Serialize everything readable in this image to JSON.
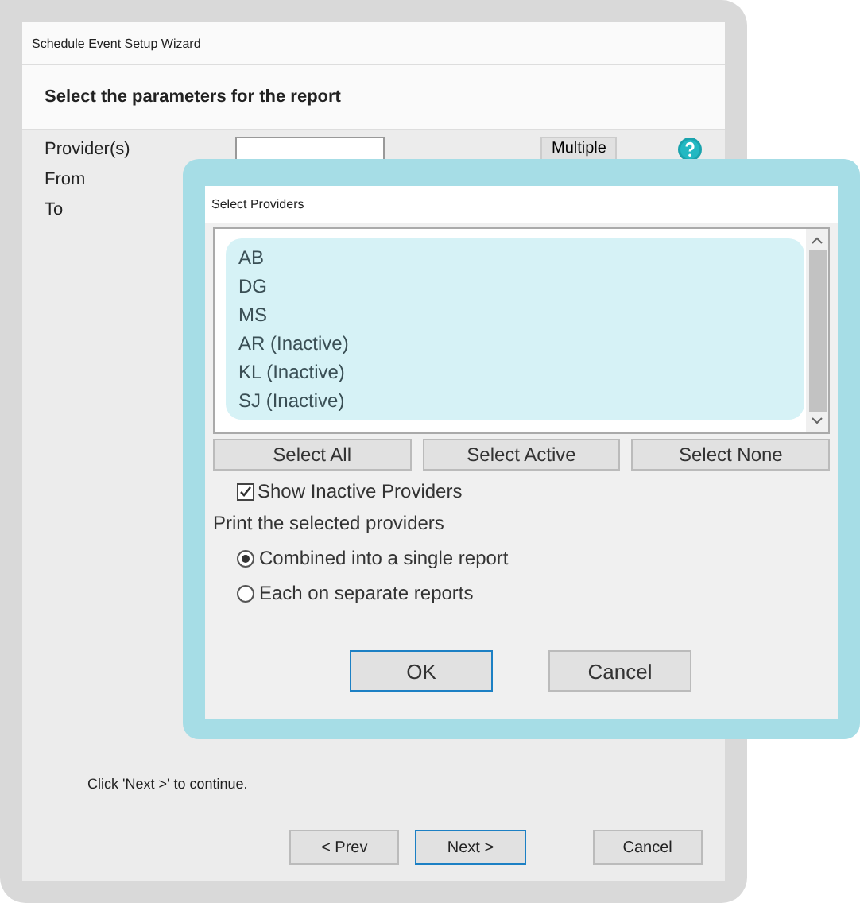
{
  "window": {
    "title": "Schedule Event Setup Wizard",
    "heading": "Select the parameters for the report"
  },
  "fields": [
    {
      "label": "Provider(s)",
      "kind": "input"
    },
    {
      "label": "From",
      "kind": "plain"
    },
    {
      "label": "To",
      "kind": "plain"
    }
  ],
  "multiple_button": {
    "label": "Multiple"
  },
  "hint": "Click 'Next >' to continue.",
  "nav_buttons": [
    {
      "label": "< Prev",
      "focused": false
    },
    {
      "label": "Next >",
      "focused": true
    },
    {
      "label": "Cancel",
      "focused": false
    }
  ],
  "dialog": {
    "title": "Select Providers",
    "providers": [
      {
        "name": "AB",
        "selected": true
      },
      {
        "name": "DG",
        "selected": true
      },
      {
        "name": "MS",
        "selected": true
      },
      {
        "name": "AR (Inactive)",
        "selected": true
      },
      {
        "name": "KL (Inactive)",
        "selected": true
      },
      {
        "name": "SJ (Inactive)",
        "selected": true
      }
    ],
    "select_buttons": [
      "Select All",
      "Select Active",
      "Select None"
    ],
    "show_inactive": {
      "label": "Show Inactive Providers",
      "checked": true
    },
    "print_label": "Print the selected providers",
    "print_options": [
      {
        "label": "Combined into a single report",
        "selected": true
      },
      {
        "label": "Each on separate reports",
        "selected": false
      }
    ],
    "buttons": [
      {
        "label": "OK",
        "focused": true
      },
      {
        "label": "Cancel",
        "focused": false
      }
    ]
  }
}
